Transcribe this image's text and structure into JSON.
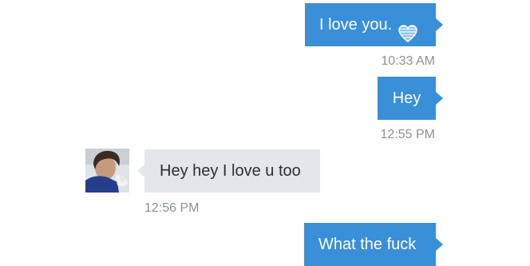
{
  "messages": [
    {
      "text": "I love you.",
      "time": "10:33 AM",
      "direction": "outgoing",
      "emoji": "heart-icon"
    },
    {
      "text": "Hey",
      "time": "12:55 PM",
      "direction": "outgoing"
    },
    {
      "text": "Hey hey I love u too",
      "time": "12:56 PM",
      "direction": "incoming"
    },
    {
      "text": "What the fuck",
      "direction": "outgoing"
    }
  ],
  "colors": {
    "outgoing_bubble": "#3a8fd9",
    "incoming_bubble": "#e2e7eb",
    "timestamp": "#8a9399"
  }
}
